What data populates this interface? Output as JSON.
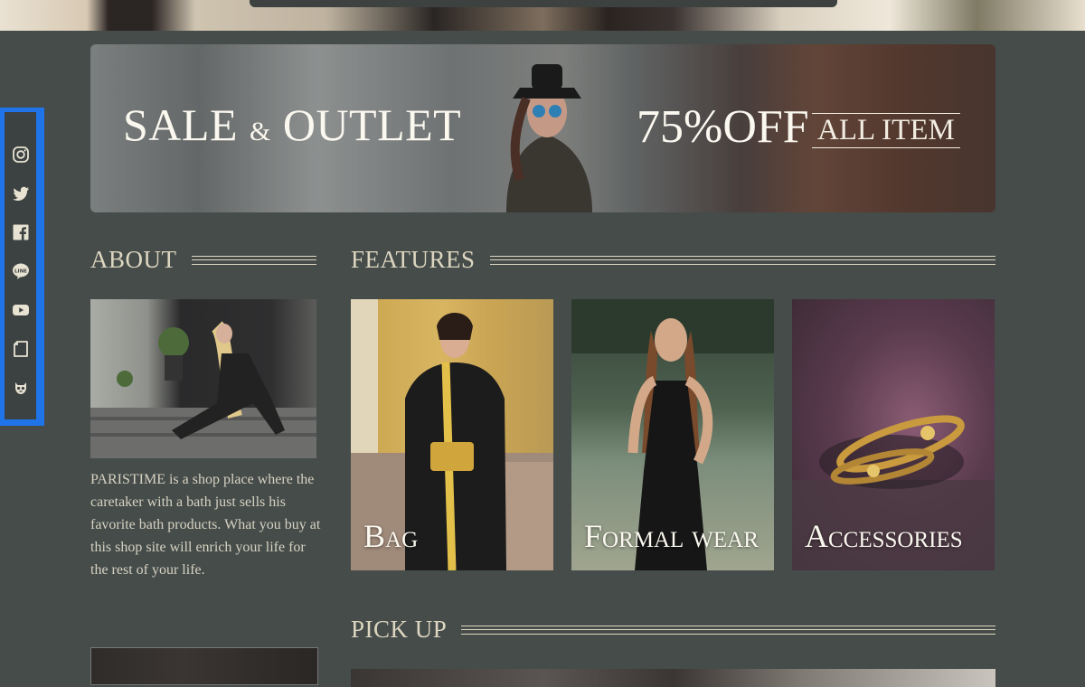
{
  "banner": {
    "title_main": "SALE",
    "title_amp": "&",
    "title_end": "OUTLET",
    "discount": "75%OFF",
    "all_item": "ALL ITEM"
  },
  "sections": {
    "about": "ABOUT",
    "features": "FEATURES",
    "pickup": "PICK UP"
  },
  "about": {
    "text": "PARISTIME is a shop place where the caretaker with a bath just sells his favorite bath products. What you buy at this shop site will enrich your life for the rest of your life."
  },
  "features": [
    {
      "label": "Bag"
    },
    {
      "label": "Formal wear"
    },
    {
      "label": "Accessories"
    }
  ],
  "sns_icons": [
    "instagram-icon",
    "twitter-icon",
    "facebook-icon",
    "line-icon",
    "youtube-icon",
    "note-icon",
    "hatena-icon"
  ],
  "colors": {
    "background": "#454c4a",
    "sidebar_highlight": "#1e74e8",
    "heading_text": "#ddd6c0"
  }
}
